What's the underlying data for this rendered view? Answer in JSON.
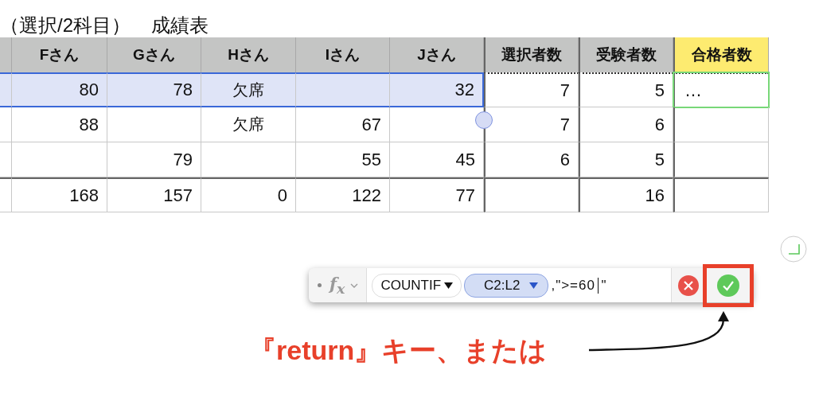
{
  "title": {
    "subject": "（選択/2科目）",
    "name": "成績表"
  },
  "table": {
    "columns": [
      {
        "label": "Fさん",
        "highlighted": false
      },
      {
        "label": "Gさん",
        "highlighted": false
      },
      {
        "label": "Hさん",
        "highlighted": false
      },
      {
        "label": "Iさん",
        "highlighted": false
      },
      {
        "label": "Jさん",
        "highlighted": false
      },
      {
        "label": "選択者数",
        "highlighted": false
      },
      {
        "label": "受験者数",
        "highlighted": false
      },
      {
        "label": "合格者数",
        "highlighted": true
      }
    ],
    "rows": [
      {
        "selected": true,
        "cells": [
          "80",
          "78",
          "欠席",
          null,
          "32",
          "7",
          "5"
        ],
        "result": {
          "text": "…",
          "active": true
        }
      },
      {
        "selected": false,
        "cells": [
          "88",
          null,
          "欠席",
          "67",
          null,
          "7",
          "6"
        ],
        "result": {
          "active": false
        }
      },
      {
        "selected": false,
        "cells": [
          null,
          "79",
          null,
          "55",
          "45",
          "6",
          "5"
        ],
        "result": {
          "active": false
        }
      },
      {
        "selected": false,
        "cells": [
          "168",
          "157",
          "0",
          "122",
          "77",
          null,
          "16"
        ],
        "result": {
          "active": false
        }
      }
    ]
  },
  "formula_bar": {
    "fx_label": "f$_{x}$",
    "function": "COUNTIF",
    "range": "C2:L2",
    "args_before_cursor": ",\">=60",
    "args_after_cursor": "\""
  },
  "annotation": {
    "text": "『return』キー、または"
  }
}
